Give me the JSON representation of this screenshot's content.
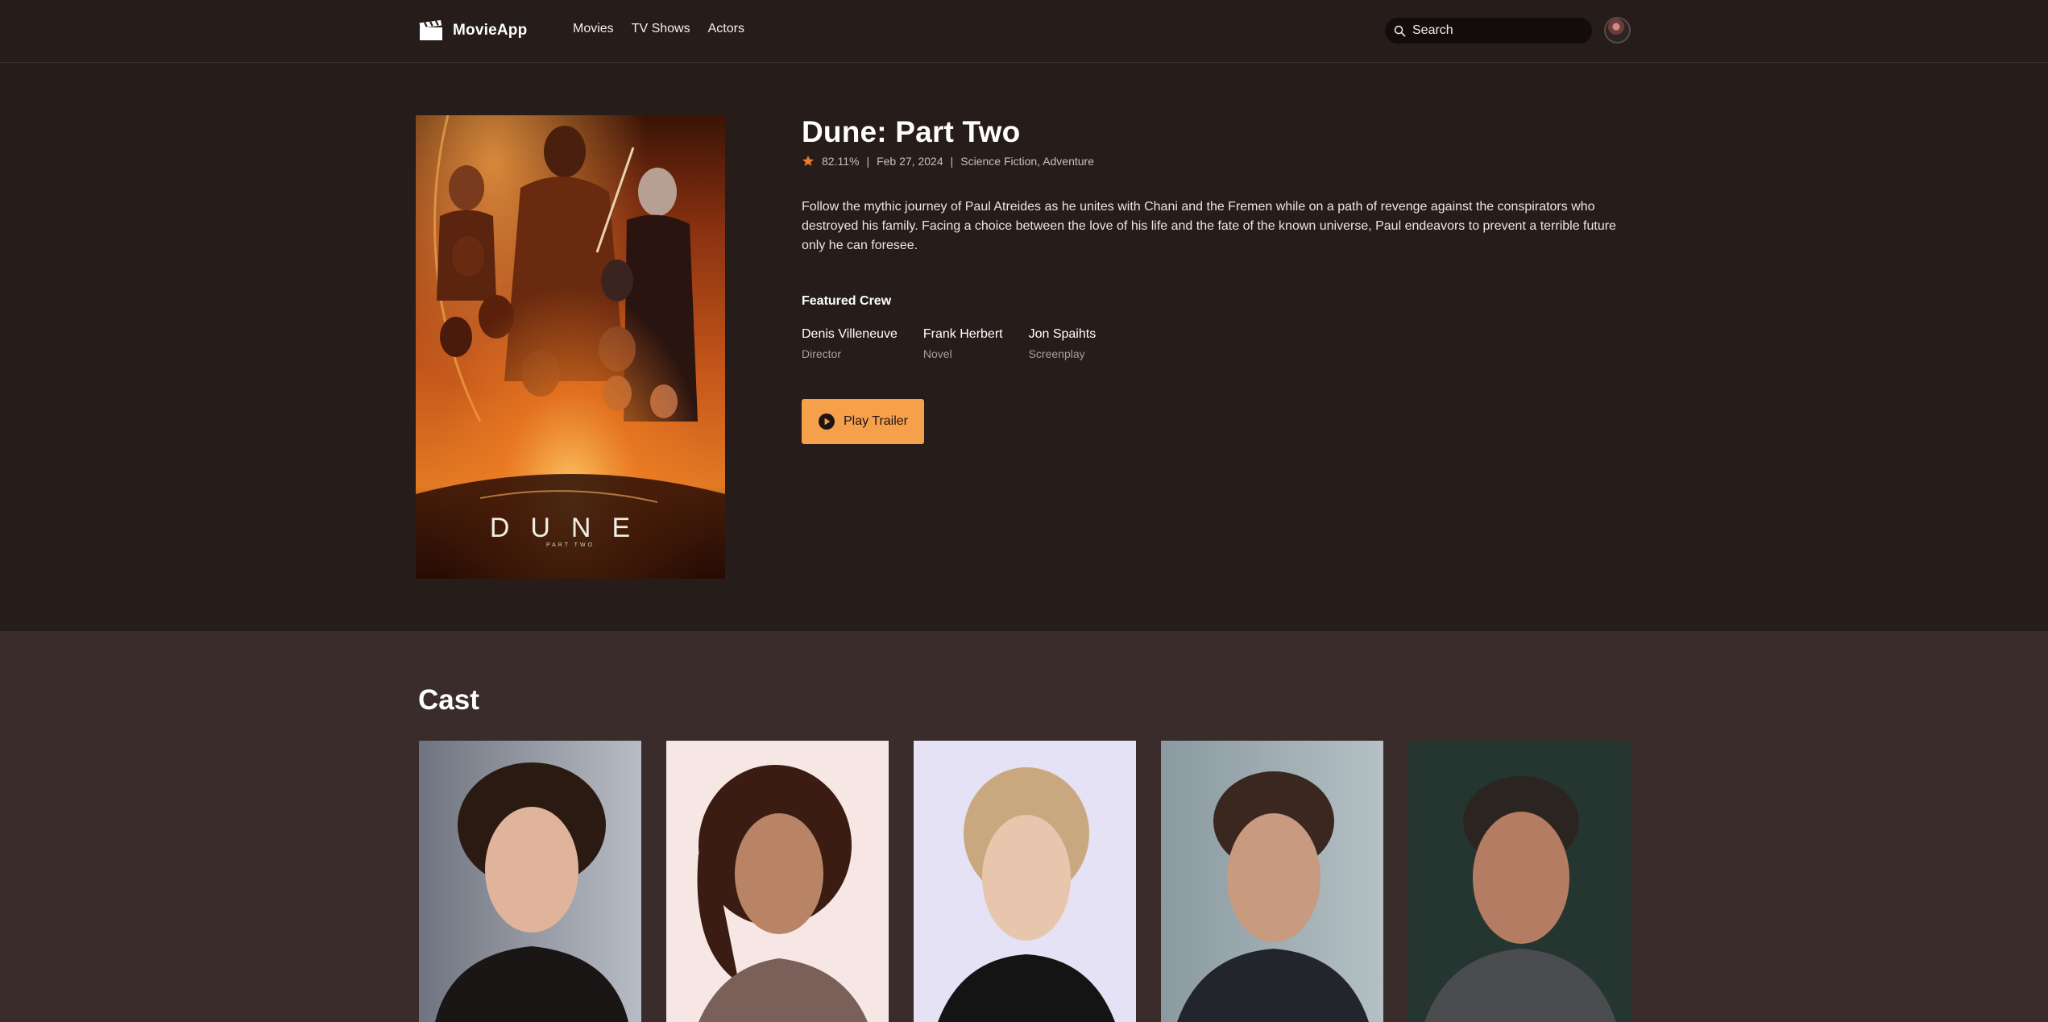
{
  "header": {
    "app_name": "MovieApp",
    "logo_icon": "clapperboard-icon",
    "nav": [
      "Movies",
      "TV Shows",
      "Actors"
    ],
    "search_placeholder": "Search"
  },
  "movie": {
    "title": "Dune: Part Two",
    "rating": "82.11%",
    "release_date": "Feb 27, 2024",
    "genres": "Science Fiction, Adventure",
    "separator": "|",
    "overview": "Follow the mythic journey of Paul Atreides as he unites with Chani and the Fremen while on a path of revenge against the conspirators who destroyed his family. Facing a choice between the love of his life and the fate of the known universe, Paul endeavors to prevent a terrible future only he can foresee.",
    "poster_title": "DUNE",
    "poster_subtitle": "PART TWO"
  },
  "crew": {
    "heading": "Featured Crew",
    "members": [
      {
        "name": "Denis Villeneuve",
        "role": "Director"
      },
      {
        "name": "Frank Herbert",
        "role": "Novel"
      },
      {
        "name": "Jon Spaihts",
        "role": "Screenplay"
      }
    ]
  },
  "actions": {
    "play_trailer": "Play Trailer"
  },
  "cast": {
    "heading": "Cast"
  },
  "colors": {
    "background": "#261c1a",
    "cast_background": "#3a2c2a",
    "accent": "#f6a04c",
    "rating_star": "#f07a2a"
  }
}
